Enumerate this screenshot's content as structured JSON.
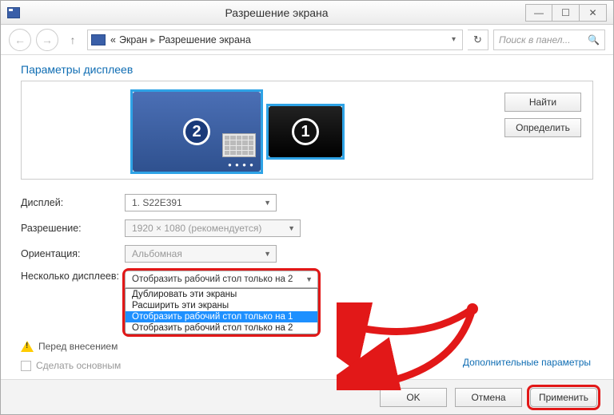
{
  "window": {
    "title": "Разрешение экрана"
  },
  "breadcrumb": {
    "chev": "«",
    "item1": "Экран",
    "item2": "Разрешение экрана"
  },
  "search": {
    "placeholder": "Поиск в панел..."
  },
  "heading": "Параметры дисплеев",
  "monitors": {
    "num1": "1",
    "num2": "2"
  },
  "buttons": {
    "find": "Найти",
    "identify": "Определить",
    "ok": "OK",
    "cancel": "Отмена",
    "apply": "Применить"
  },
  "labels": {
    "display": "Дисплей:",
    "resolution": "Разрешение:",
    "orientation": "Ориентация:",
    "multiple": "Несколько дисплеев:",
    "warn_prefix": "Перед внесением",
    "make_primary": "Сделать основным ",
    "advanced": "Дополнительные параметры"
  },
  "values": {
    "display": "1. S22E391",
    "resolution": "1920 × 1080 (рекомендуется)",
    "orientation": "Альбомная",
    "multiple_selected": "Отобразить рабочий стол только на 2"
  },
  "dropdown": {
    "opt0": "Дублировать эти экраны",
    "opt1": "Расширить эти экраны",
    "opt2": "Отобразить рабочий стол только на 1",
    "opt3": "Отобразить рабочий стол только на 2"
  }
}
